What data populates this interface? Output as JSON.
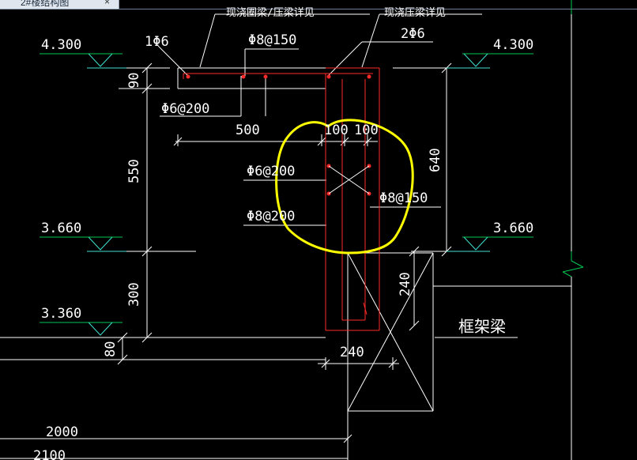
{
  "tab": {
    "title": "2#楼结构图",
    "close_glyph": "×"
  },
  "notes": {
    "top_left": "现浇圈梁/压梁详见",
    "top_right": "现浇压梁详见"
  },
  "levels": {
    "l1": "4.300",
    "l2": "4.300",
    "l3": "3.660",
    "l4": "3.660",
    "l5": "3.360"
  },
  "rebar": {
    "r1": "1Φ6",
    "r2": "Φ8@150",
    "r3": "2Φ6",
    "r4": "Φ6@200",
    "r5": "Φ6@200",
    "r6": "Φ8@200",
    "r7": "Φ8@150"
  },
  "dims": {
    "d90": "90",
    "d500": "500",
    "d100a": "100",
    "d100b": "100",
    "d550": "550",
    "d640": "640",
    "d300": "300",
    "d240v": "240",
    "d80": "80",
    "d240h": "240",
    "d2000": "2000",
    "d2100": "2100"
  },
  "labels": {
    "frame_beam": "框架梁"
  },
  "colors": {
    "white": "#ffffff",
    "red": "#ff2a2a",
    "green": "#00c853",
    "yellow": "#ffff00",
    "cyan": "#40e0d0"
  }
}
